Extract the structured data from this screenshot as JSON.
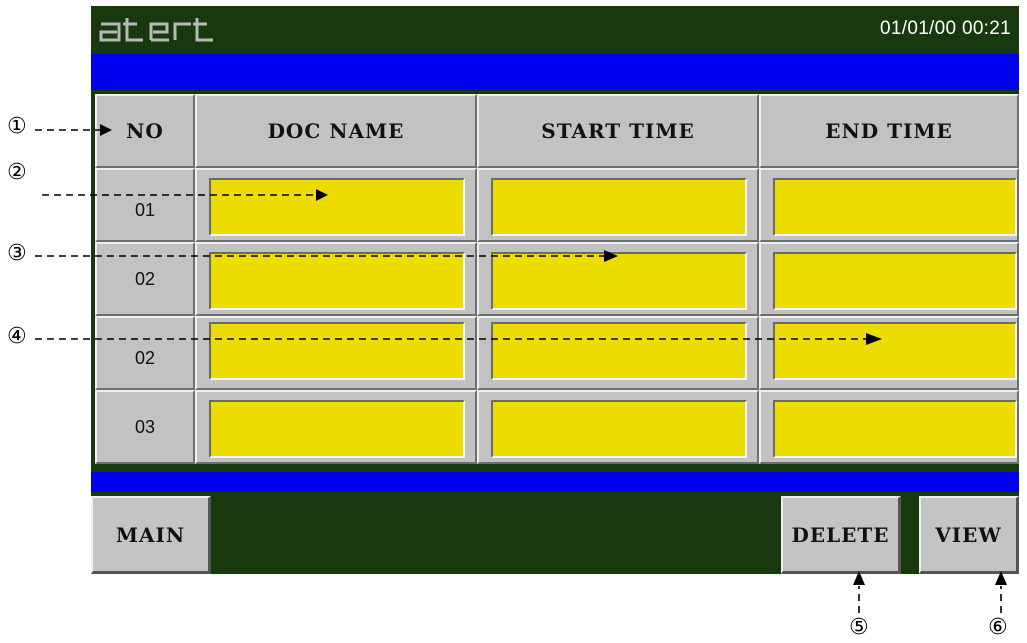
{
  "header": {
    "logo_text": "atert",
    "datetime": "01/01/00 00:21"
  },
  "table": {
    "columns": [
      "NO",
      "DOC NAME",
      "START TIME",
      "END TIME"
    ],
    "rows": [
      {
        "no": "01",
        "doc_name": "",
        "start_time": "",
        "end_time": ""
      },
      {
        "no": "02",
        "doc_name": "",
        "start_time": "",
        "end_time": ""
      },
      {
        "no": "02",
        "doc_name": "",
        "start_time": "",
        "end_time": ""
      },
      {
        "no": "03",
        "doc_name": "",
        "start_time": "",
        "end_time": ""
      }
    ]
  },
  "buttons": {
    "main": "MAIN",
    "delete": "DELETE",
    "view": "VIEW"
  },
  "annotations": [
    "①",
    "②",
    "③",
    "④",
    "⑤",
    "⑥"
  ],
  "colors": {
    "panel_bg": "#18380d",
    "band": "#0000f0",
    "cell": "#c2c2c2",
    "field": "#ecdc00"
  }
}
